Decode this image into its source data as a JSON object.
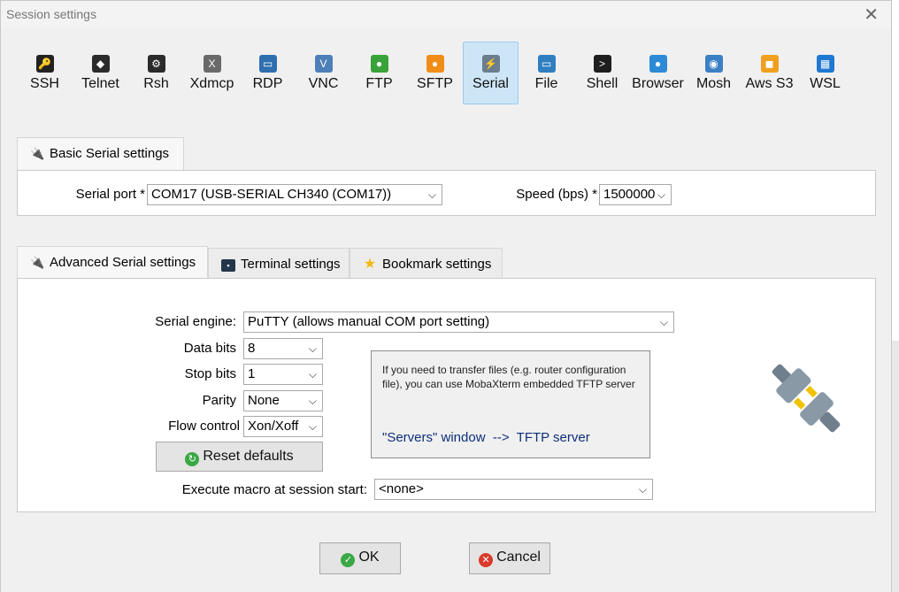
{
  "window": {
    "title": "Session settings",
    "close_icon": "close-icon"
  },
  "protocols": [
    {
      "label": "SSH",
      "icon": "key-icon",
      "color": "#222222",
      "glyph": "🔑"
    },
    {
      "label": "Telnet",
      "icon": "telnet-icon",
      "color": "#2b2b2b",
      "glyph": "◆"
    },
    {
      "label": "Rsh",
      "icon": "rsh-icon",
      "color": "#2b2b2b",
      "glyph": "⚙"
    },
    {
      "label": "Xdmcp",
      "icon": "x-display-icon",
      "color": "#6a6a6a",
      "glyph": "X"
    },
    {
      "label": "RDP",
      "icon": "monitor-icon",
      "color": "#2f6fb0",
      "glyph": "▭"
    },
    {
      "label": "VNC",
      "icon": "vnc-icon",
      "color": "#4d7fb8",
      "glyph": "V"
    },
    {
      "label": "FTP",
      "icon": "globe-green-icon",
      "color": "#3aa23a",
      "glyph": "●"
    },
    {
      "label": "SFTP",
      "icon": "globe-orange-icon",
      "color": "#f08c1a",
      "glyph": "●"
    },
    {
      "label": "Serial",
      "icon": "plug-icon",
      "color": "#6b7d8e",
      "glyph": "⚡"
    },
    {
      "label": "File",
      "icon": "file-monitor-icon",
      "color": "#2f7fc0",
      "glyph": "▭"
    },
    {
      "label": "Shell",
      "icon": "terminal-icon",
      "color": "#1e1e1e",
      "glyph": ">"
    },
    {
      "label": "Browser",
      "icon": "globe-icon",
      "color": "#2c8ad6",
      "glyph": "●"
    },
    {
      "label": "Mosh",
      "icon": "satellite-icon",
      "color": "#3b7fc4",
      "glyph": "◉"
    },
    {
      "label": "Aws S3",
      "icon": "aws-cubes-icon",
      "color": "#f0a020",
      "glyph": "◼"
    },
    {
      "label": "WSL",
      "icon": "windows-icon",
      "color": "#1f78d1",
      "glyph": "▦"
    }
  ],
  "active_protocol": "Serial",
  "basic": {
    "tab_label": "Basic Serial settings",
    "serial_port_label": "Serial port *",
    "serial_port_value": "COM17  (USB-SERIAL CH340 (COM17))",
    "speed_label": "Speed (bps) *",
    "speed_value": "1500000"
  },
  "advanced_tabs": [
    {
      "label": "Advanced Serial settings",
      "icon": "plug-icon"
    },
    {
      "label": "Terminal settings",
      "icon": "terminal-settings-icon"
    },
    {
      "label": "Bookmark settings",
      "icon": "star-icon"
    }
  ],
  "advanced": {
    "engine_label": "Serial engine:",
    "engine_value": "PuTTY    (allows manual COM port setting)",
    "data_bits_label": "Data bits",
    "data_bits_value": "8",
    "stop_bits_label": "Stop bits",
    "stop_bits_value": "1",
    "parity_label": "Parity",
    "parity_value": "None",
    "flow_label": "Flow control",
    "flow_value": "Xon/Xoff",
    "reset_label": "Reset defaults",
    "info_text": "If you need to transfer files (e.g. router configuration file), you can use MobaXterm embedded TFTP server",
    "info_link": "\"Servers\" window  -->  TFTP server",
    "macro_label": "Execute macro at session start:",
    "macro_value": "<none>"
  },
  "footer": {
    "ok_label": "OK",
    "cancel_label": "Cancel"
  },
  "colors": {
    "active_tab_bg": "#cde6f7",
    "link": "#0d2f7a",
    "ok_green": "#3aa845",
    "cancel_red": "#d93a2b"
  }
}
